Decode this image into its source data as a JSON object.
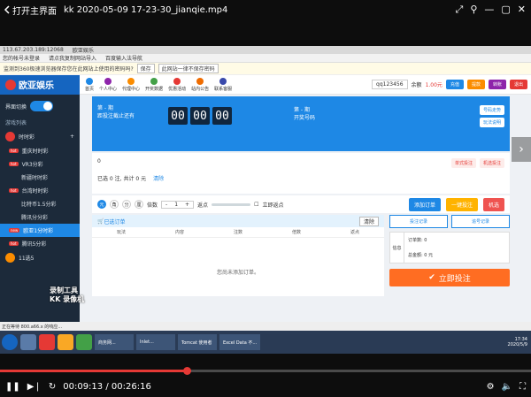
{
  "player": {
    "back_label": "打开主界面",
    "file_title": "kk 2020-05-09 17-23-30_jianqie.mp4",
    "current_time": "00:09:13",
    "total_time": "00:26:16",
    "progress": 0.351
  },
  "video": {
    "browser": {
      "url_text": "113.67.203.189:12068",
      "tab_text": "欧亚娱乐",
      "bookmark1": "您的帐号未登录",
      "bookmark2": "请点我复制网站导入",
      "bookmark3": "百度输入法导航",
      "notice": "监测到360极速浏览器保存您在此网站上使用的密码吗?",
      "notice_save": "保存",
      "notice_never": "此网站一律不保存密码"
    },
    "app": {
      "logo": "欧亚娱乐",
      "nav_items": [
        {
          "label": "首页",
          "color": "#1e88e5"
        },
        {
          "label": "个人中心",
          "color": "#8e24aa"
        },
        {
          "label": "代理中心",
          "color": "#fb8c00"
        },
        {
          "label": "开奖数据",
          "color": "#43a047"
        },
        {
          "label": "优惠活动",
          "color": "#e53935"
        },
        {
          "label": "站内公告",
          "color": "#ef6c00"
        },
        {
          "label": "联系客服",
          "color": "#3949ab"
        }
      ],
      "username": "qq123456",
      "balance_label": "余额",
      "balance": "1.00元",
      "btn_recharge": "充值",
      "btn_withdraw": "提款",
      "btn_transfer": "转账",
      "btn_logout": "退出"
    },
    "sidebar": {
      "interface_switch": "界面切换",
      "game_list": "游戏列表",
      "games": [
        {
          "name": "时时彩",
          "icon": "lottery-icon"
        }
      ],
      "subs": [
        {
          "tag": "hot",
          "label": "重庆时时彩"
        },
        {
          "tag": "hot",
          "label": "VR3分彩"
        },
        {
          "tag": "",
          "label": "新疆时时彩"
        },
        {
          "tag": "hot",
          "label": "台湾时时彩"
        },
        {
          "tag": "",
          "label": "比特币1.5分彩"
        },
        {
          "tag": "",
          "label": "腾讯分分彩"
        },
        {
          "tag": "new",
          "label": "欧亚1分时彩"
        },
        {
          "tag": "hot",
          "label": "腾讯5分彩"
        }
      ],
      "game2": "11选5"
    },
    "banner": {
      "issue_label": "第 - 期",
      "issue_sub": "距投注截止还有",
      "timer": [
        "00",
        "00",
        "00"
      ],
      "prev_label": "第 - 期",
      "prev_sub": "开奖号码",
      "btn_trend": "号码走势",
      "btn_rules": "玩法说明"
    },
    "card": {
      "count": "0",
      "summary": "已选 0 注, 共计 0 元",
      "clear_link": "清除",
      "pill1": "单式投注",
      "pill2": "机选投注"
    },
    "toolbar": {
      "c1": "元",
      "c2": "角",
      "c3": "分",
      "c4": "厘",
      "multiple_label": "倍数",
      "multiple_value": "1",
      "rebate_label": "返点",
      "realtime": "立即返点",
      "btn_add": "添加订单",
      "btn_quick": "一键投注",
      "btn_random": "机选"
    },
    "orders": {
      "title": "已选订单",
      "clear": "清除",
      "columns": [
        "玩法",
        "内容",
        "注数",
        "倍数",
        "返点"
      ],
      "empty": "您尚未添加订单。"
    },
    "right": {
      "btn_record": "投注记录",
      "btn_chase": "追号记录",
      "side_label": "信息",
      "total_label": "订单数:",
      "total_value": "0",
      "amount_label": "总金额:",
      "amount_value": "0 元",
      "bet_btn": "立即投注"
    },
    "watermark": [
      "录制工具",
      "KK 录像机"
    ],
    "status_text": "正在等待 800.a66.x 的响应...",
    "taskbar": {
      "windows": [
        "商务网...",
        "Inlet...",
        "Tomcat 使用者",
        "Excel Data 不..."
      ],
      "time": "17:34",
      "date": "2020/5/9"
    }
  }
}
